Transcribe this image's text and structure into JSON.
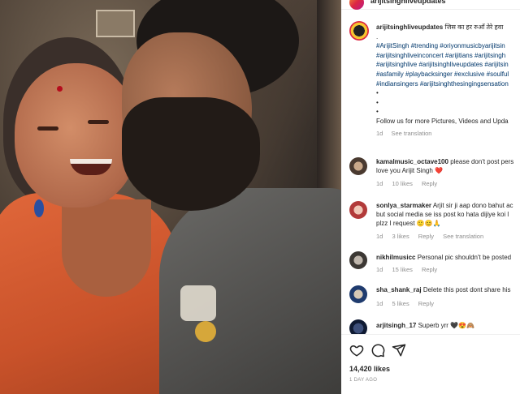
{
  "header": {
    "username": "arijitsinghliveupdates"
  },
  "caption": {
    "username": "arijitsinghliveupdates",
    "text": "जिस का हर रुआँ तेरे हवा",
    "dot": ".",
    "hashtag_lines": [
      "#ArijitSingh #trending #oriyonmusicbyarijitsin",
      "#arijitsinghliveinconcert #arijitians #arijitsingh",
      "#arijitsinghlive #arijitsinghliveupdates #arijitsin",
      "#asfamily #playbacksinger #exclusive #soulful",
      "#indiansingers #arijitsinghthesingingsensation"
    ],
    "bullets": [
      "•",
      "•",
      "•"
    ],
    "footer": "Follow us for more Pictures, Videos and Upda",
    "time": "1d",
    "see_translation": "See translation"
  },
  "comments": [
    {
      "username": "kamalmusic_octave100",
      "lines": [
        "please don't post pers",
        "love you Arijit Singh ❤️"
      ],
      "time": "1d",
      "likes": "10 likes",
      "reply": "Reply"
    },
    {
      "username": "sonlya_starmaker",
      "lines": [
        "Arjit sir ji aap dono bahut ac",
        "but social media se iss post ko hata dijiye koi l",
        "plzz I request 🙂😊🙏"
      ],
      "time": "1d",
      "likes": "3 likes",
      "reply": "Reply",
      "see_translation": "See translation"
    },
    {
      "username": "nikhilmusicc",
      "lines": [
        "Personal pic shouldn't be posted"
      ],
      "time": "1d",
      "likes": "15 likes",
      "reply": "Reply"
    },
    {
      "username": "sha_shank_raj",
      "lines": [
        "Delete this post dont share his"
      ],
      "time": "1d",
      "likes": "5 likes",
      "reply": "Reply"
    },
    {
      "username": "arjitsingh_17",
      "lines": [
        "Superb yrr 🖤😍🙈"
      ],
      "time": "",
      "likes": "",
      "reply": ""
    }
  ],
  "actions": {
    "like_icon": "heart-icon",
    "comment_icon": "comment-icon",
    "share_icon": "share-icon",
    "likes_count": "14,420 likes",
    "posted": "1 DAY AGO"
  },
  "colors": {
    "hashtag": "#00376b",
    "muted": "#8e8e8e",
    "text": "#262626"
  }
}
